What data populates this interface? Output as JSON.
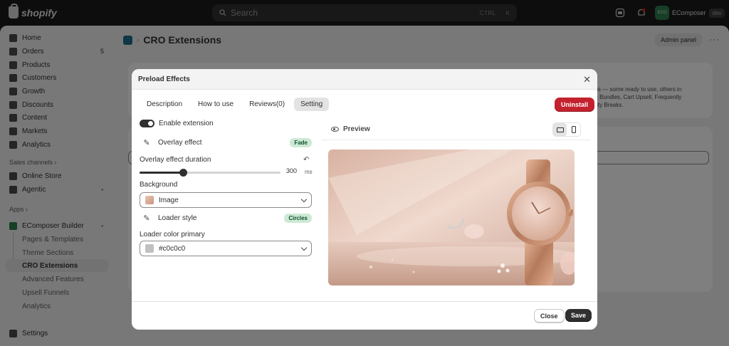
{
  "topbar": {
    "logo_text": "shopify",
    "search_placeholder": "Search",
    "shortcut_ctrl": "CTRL",
    "shortcut_key": "K",
    "store_avatar": "ECO",
    "store_name": "EComposer",
    "store_tag": "dev"
  },
  "sidebar": {
    "items": [
      {
        "label": "Home"
      },
      {
        "label": "Orders",
        "badge": "5"
      },
      {
        "label": "Products"
      },
      {
        "label": "Customers"
      },
      {
        "label": "Growth"
      },
      {
        "label": "Discounts"
      },
      {
        "label": "Content"
      },
      {
        "label": "Markets"
      },
      {
        "label": "Analytics"
      }
    ],
    "sales_channels_heading": "Sales channels",
    "channels": [
      {
        "label": "Online Store"
      },
      {
        "label": "Agentic"
      }
    ],
    "apps_heading": "Apps",
    "app": {
      "label": "EComposer Builder"
    },
    "app_sub": [
      {
        "label": "Pages & Templates"
      },
      {
        "label": "Theme Sections"
      },
      {
        "label": "CRO Extensions"
      },
      {
        "label": "Advanced Features"
      },
      {
        "label": "Upsell Funnels"
      },
      {
        "label": "Analytics"
      }
    ],
    "settings_label": "Settings"
  },
  "page": {
    "title": "CRO Extensions",
    "admin_panel_label": "Admin panel",
    "bg_description": "tions — some ready to use, others in\ndes Bundles, Cart Upsell, Frequently\nantity Breaks."
  },
  "modal": {
    "title": "Preload Effects",
    "tabs": [
      {
        "label": "Description"
      },
      {
        "label": "How to use"
      },
      {
        "label": "Reviews(0)"
      },
      {
        "label": "Setting"
      }
    ],
    "uninstall_label": "Uninstall",
    "enable_label": "Enable extension",
    "overlay_effect_label": "Overlay effect",
    "overlay_effect_value": "Fade",
    "duration_label": "Overlay effect duration",
    "duration_value": "300",
    "duration_unit": "ms",
    "duration_fraction": 0.31,
    "background_label": "Background",
    "background_value": "Image",
    "loader_style_label": "Loader style",
    "loader_style_value": "Circles",
    "loader_color_label": "Loader color primary",
    "loader_color_value": "#c0c0c0",
    "loader_color_hex": "#c0c0c0",
    "preview_label": "Preview",
    "close_label": "Close",
    "save_label": "Save"
  },
  "colors": {
    "accent_danger": "#c4212f",
    "success_pill": "#cde9d4",
    "primary_dark": "#303030"
  }
}
